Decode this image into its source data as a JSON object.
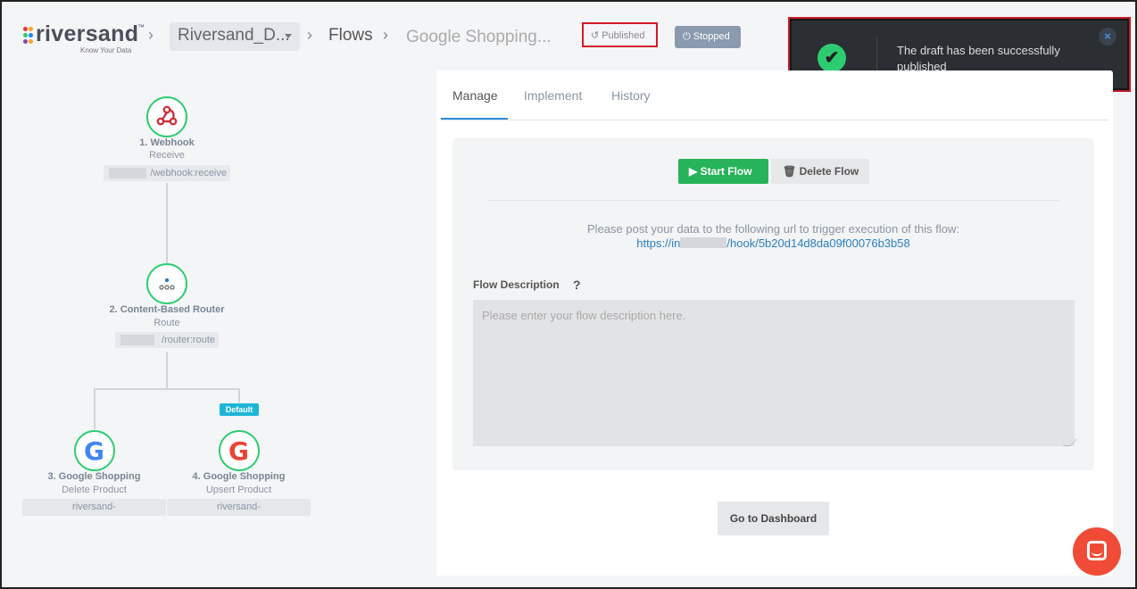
{
  "header": {
    "logo": {
      "word": "riversand",
      "trademark": "™",
      "tagline": "Know Your Data"
    },
    "breadcrumb": {
      "separator": "›",
      "tenant": "Riversand_D...",
      "flows": "Flows",
      "flow_name": "Google Shopping..."
    },
    "published_label": "Published",
    "published_icon": "↺",
    "stopped_label": "Stopped",
    "stopped_icon": "⏻"
  },
  "toast": {
    "message": "The draft has been successfully published",
    "check_icon": "✔",
    "close_icon": "×"
  },
  "flow": {
    "nodes": [
      {
        "title": "1. Webhook",
        "subtitle": "Receive",
        "pill": "/webhook:receive"
      },
      {
        "title": "2. Content-Based Router",
        "subtitle": "Route",
        "pill": "/router:route"
      },
      {
        "title": "3. Google Shopping",
        "subtitle": "Delete Product",
        "pill": "riversand-"
      },
      {
        "title": "4. Google Shopping",
        "subtitle": "Upsert Product",
        "pill": "riversand-"
      }
    ],
    "default_badge": "Default",
    "google_letter": "G"
  },
  "panel": {
    "tabs": [
      {
        "label": "Manage"
      },
      {
        "label": "Implement"
      },
      {
        "label": "History"
      }
    ],
    "start_flow": "Start Flow",
    "start_icon": "▶",
    "delete_flow": "Delete Flow",
    "delete_icon": "🗑",
    "post_note": "Please post your data to the following url to trigger execution of this flow:",
    "url_prefix": "https://in",
    "url_suffix": "/hook/5b20d14d8da09f00076b3b58",
    "description_label": "Flow Description",
    "help_icon": "?",
    "description_placeholder": "Please enter your flow description here.",
    "description_value": "",
    "dashboard_button": "Go to Dashboard"
  },
  "colors": {
    "success": "#27b35a",
    "accent": "#2a8bd8",
    "badge_default": "#1eb6d8",
    "stopped": "#8a9bb0",
    "highlight": "#d11a2a",
    "chat": "#f04b36"
  }
}
